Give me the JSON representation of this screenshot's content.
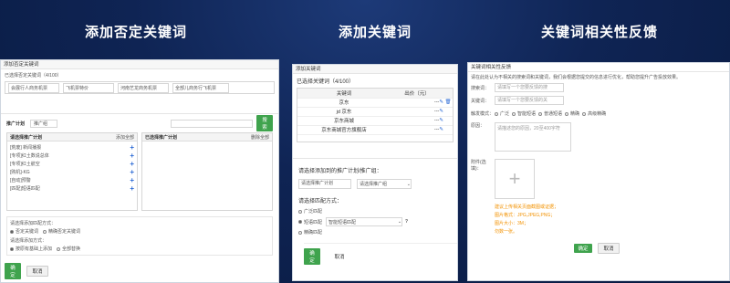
{
  "headings": [
    "添加否定关键词",
    "添加关键词",
    "关键词相关性反馈"
  ],
  "left": {
    "title": "添加否定关键词",
    "count_label": "已选择否定关键词（4/100）",
    "chips": [
      "会展行人商务机票",
      "飞机票特价",
      "河南艺龙商务机票",
      "全部儿商务行飞机票"
    ],
    "tabs": [
      "推广计划",
      "推广组"
    ],
    "search_button": "搜索",
    "list_header": "请选择推广计划",
    "add_all": "添加全部",
    "selected_header": "已选择推广计划",
    "delete_all": "删除全部",
    "plans": [
      "[荒废] 新闻播报",
      "[专项]红土数说总体",
      "[专项]红土航空",
      "[购机]-KG",
      "[自动]预警",
      "[匹配]短语匹配"
    ],
    "match_label": "请选择添加匹配方式：",
    "match_options": [
      "否定关键词",
      "精确否定关键词"
    ],
    "method_label": "请选择添加方式：",
    "method_options": [
      "按原有基础上添加",
      "全部替换"
    ],
    "ok": "确定",
    "cancel": "取消"
  },
  "middle": {
    "title": "添加关键词",
    "count_label": "已选择关键词（4/100）",
    "col_keyword": "关键词",
    "col_bid": "出价（元）",
    "keywords": [
      "京东",
      "jd 京东",
      "京东商城",
      "京东商城官方旗舰店"
    ],
    "bid_dash": "---",
    "target_label": "请选择添加到的推广计划/推广组：",
    "plan_select": "请选择推广计划",
    "group_select": "请选择推广组",
    "match_label": "请选择匹配方式：",
    "match_options": [
      "广泛匹配",
      "短语匹配",
      "精确匹配"
    ],
    "match_select": "智能短语匹配",
    "ok": "确定",
    "cancel": "取消"
  },
  "right": {
    "title": "关键词相关性反馈",
    "desc": "请在此处认为不相关的搜索词和关键词，我们会根据您提交的信息进行优化，帮助您提升广告投放效果。",
    "search_label": "搜索词：",
    "search_placeholder": "请填写一个您要反馈的搜",
    "keyword_label": "关键词：",
    "keyword_placeholder": "请填写一个您要反馈的关",
    "trigger_label": "触发模式：",
    "trigger_options": [
      "广泛",
      "智能短语",
      "普通短语",
      "精确",
      "高级精确"
    ],
    "reason_label": "原因：",
    "reason_placeholder": "请描述您的原因，20至400字符",
    "attach_label": "附件(选填)：",
    "hint_lines": [
      "建议上传相关页面截图或证据；",
      "图片格式：JPG,JPEG,PNG；",
      "图片大小：3M；",
      "勿数一张。"
    ],
    "ok": "确定",
    "cancel": "取消"
  }
}
